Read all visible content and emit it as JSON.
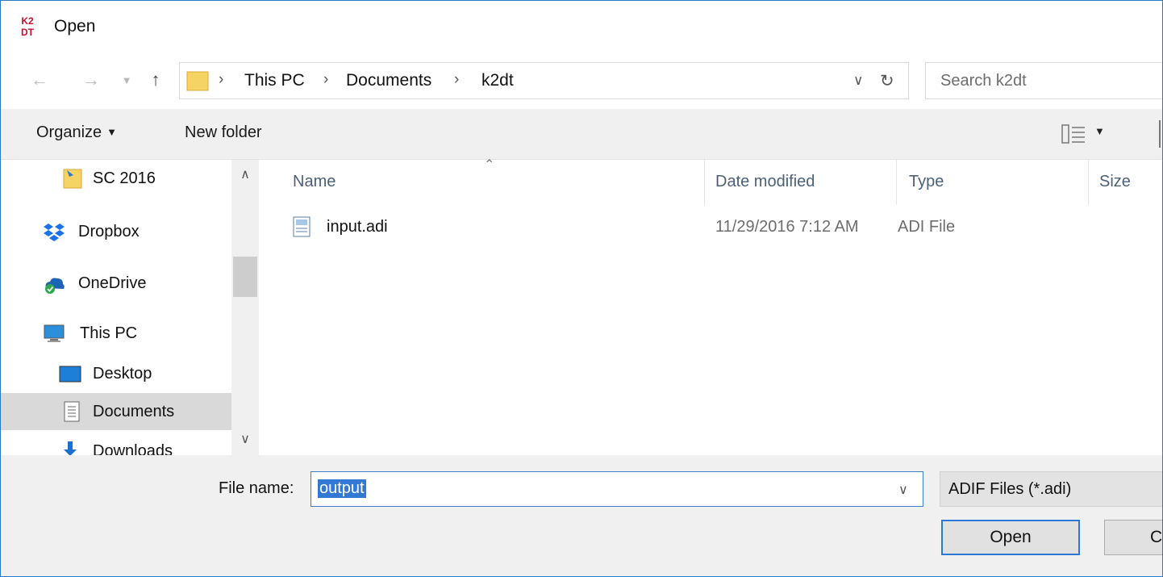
{
  "window": {
    "title": "Open",
    "logo_text": [
      "K2",
      "DT"
    ]
  },
  "navigation": {
    "back_icon": "arrow-left-icon",
    "forward_icon": "arrow-right-icon",
    "recent_icon": "chevron-down-icon",
    "up_icon": "arrow-up-icon",
    "breadcrumb": [
      "This PC",
      "Documents",
      "k2dt"
    ],
    "search_placeholder": "Search k2dt"
  },
  "commandbar": {
    "organize_label": "Organize",
    "new_folder_label": "New folder"
  },
  "sidebar": {
    "items": [
      {
        "label": "SC 2016",
        "icon": "pinned-folder-icon",
        "indent": 1,
        "selected": false
      },
      {
        "label": "Dropbox",
        "icon": "dropbox-icon",
        "indent": 0,
        "selected": false
      },
      {
        "label": "OneDrive",
        "icon": "onedrive-icon",
        "indent": 0,
        "selected": false
      },
      {
        "label": "This PC",
        "icon": "computer-icon",
        "indent": 0,
        "selected": false
      },
      {
        "label": "Desktop",
        "icon": "desktop-icon",
        "indent": 1,
        "selected": false
      },
      {
        "label": "Documents",
        "icon": "documents-icon",
        "indent": 1,
        "selected": true
      },
      {
        "label": "Downloads",
        "icon": "downloads-icon",
        "indent": 1,
        "selected": false
      }
    ]
  },
  "filelist": {
    "columns": [
      "Name",
      "Date modified",
      "Type",
      "Size"
    ],
    "rows": [
      {
        "name": "input.adi",
        "date": "11/29/2016 7:12 AM",
        "type": "ADI File",
        "size": ""
      }
    ]
  },
  "bottom": {
    "filename_label": "File name:",
    "filename_value": "output",
    "filter_value": "ADIF Files (*.adi)",
    "open_label": "Open",
    "cancel_label": "Ca"
  },
  "colors": {
    "accent": "#2b79d4",
    "selection": "#3378d4",
    "header_text": "#4c607a",
    "chrome": "#f0f0f0"
  }
}
